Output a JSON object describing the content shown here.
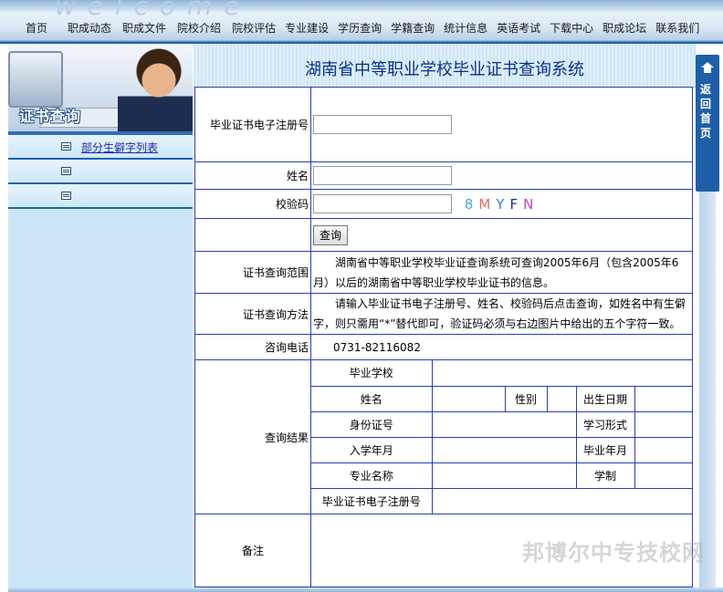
{
  "banner": {
    "decor_text": "w e l c o m e"
  },
  "nav": {
    "items": [
      "首页",
      "职成动态",
      "职成文件",
      "院校介绍",
      "院校评估",
      "专业建设",
      "学历查询",
      "学籍查询",
      "统计信息",
      "英语考试",
      "下载中心",
      "职成论坛",
      "联系我们"
    ]
  },
  "sidebar": {
    "title": "证书查询",
    "links": [
      "部分生僻字列表",
      "",
      ""
    ]
  },
  "header": {
    "title": "湖南省中等职业学校毕业证书查询系统"
  },
  "return_bar": {
    "label": "返回首页"
  },
  "form": {
    "cert_label": "毕业证书电子注册号",
    "cert_value": "",
    "name_label": "姓名",
    "name_value": "",
    "captcha_label": "校验码",
    "captcha_value": "",
    "captcha_chars": [
      "8",
      "M",
      "Y",
      "F",
      "N"
    ],
    "query_button": "查询",
    "scope_label": "证书查询范围",
    "scope_text": "湖南省中等职业学校毕业证查询系统可查询2005年6月（包含2005年6月）以后的湖南省中等职业学校毕业证书的信息。",
    "method_label": "证书查询方法",
    "method_text": "请输入毕业证书电子注册号、姓名、校验码后点击查询，如姓名中有生僻字，则只需用“*”替代即可，验证码必须与右边图片中给出的五个字符一致。",
    "phone_label": "咨询电话",
    "phone_value": "0731-82116082",
    "result_label": "查询结果",
    "remark_label": "备注"
  },
  "result": {
    "school": "毕业学校",
    "name": "姓名",
    "gender": "性别",
    "birth": "出生日期",
    "id_no": "身份证号",
    "study_form": "学习形式",
    "enroll": "入学年月",
    "graduate": "毕业年月",
    "major": "专业名称",
    "duration": "学制",
    "cert_no": "毕业证书电子注册号"
  },
  "watermark": "邦博尔中专技校网"
}
